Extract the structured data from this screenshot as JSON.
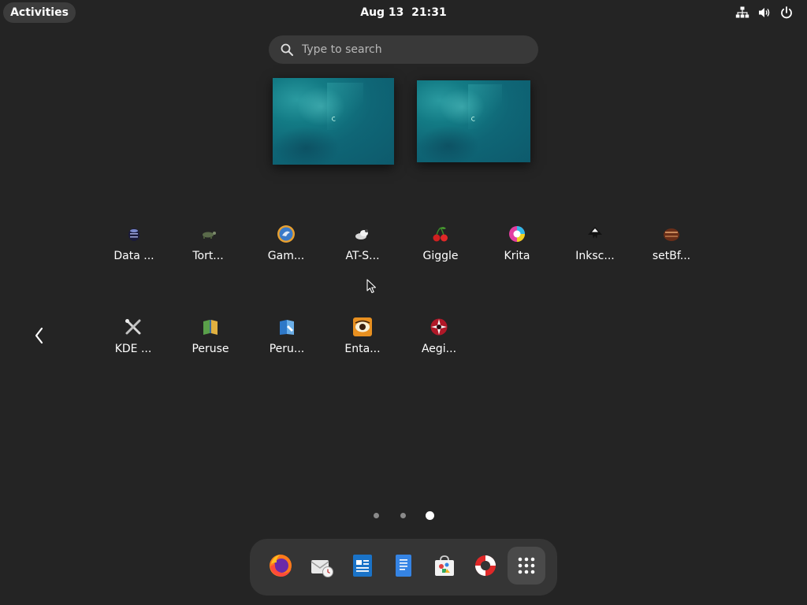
{
  "topbar": {
    "activities_label": "Activities",
    "clock_date": "Aug 13",
    "clock_time": "21:31",
    "tray_icons": [
      "network-icon",
      "volume-icon",
      "power-icon"
    ]
  },
  "search": {
    "placeholder": "Type to search",
    "value": ""
  },
  "workspaces": [
    {
      "name": "workspace-1"
    },
    {
      "name": "workspace-2"
    }
  ],
  "app_grid": {
    "rows": [
      [
        {
          "label": "Data ...",
          "icon": "data-icon"
        },
        {
          "label": "Tort...",
          "icon": "tortoise-icon"
        },
        {
          "label": "Gam...",
          "icon": "game-icon"
        },
        {
          "label": "AT-S...",
          "icon": "at-spi-icon"
        },
        {
          "label": "Giggle",
          "icon": "cherry-icon"
        },
        {
          "label": "Krita",
          "icon": "krita-icon"
        },
        {
          "label": "Inksc...",
          "icon": "inkscape-icon"
        },
        {
          "label": "setBf...",
          "icon": "setbf-icon"
        }
      ],
      [
        {
          "label": "KDE ...",
          "icon": "tools-icon"
        },
        {
          "label": "Peruse",
          "icon": "peruse-icon"
        },
        {
          "label": "Peru...",
          "icon": "peruse-creator-icon"
        },
        {
          "label": "Enta...",
          "icon": "eye-icon"
        },
        {
          "label": "Aegi...",
          "icon": "aegisub-icon"
        }
      ]
    ]
  },
  "pager": {
    "pages": 3,
    "current": 3
  },
  "dash": {
    "items": [
      {
        "name": "firefox",
        "icon": "firefox-icon"
      },
      {
        "name": "evolution",
        "icon": "mail-clock-icon"
      },
      {
        "name": "writer",
        "icon": "writer-icon"
      },
      {
        "name": "text-editor",
        "icon": "text-editor-icon"
      },
      {
        "name": "software",
        "icon": "software-bag-icon"
      },
      {
        "name": "help",
        "icon": "lifebuoy-icon"
      },
      {
        "name": "show-apps",
        "icon": "app-grid-icon"
      }
    ]
  },
  "colors": {
    "background": "#242424",
    "panel_button": "#3c3c3c",
    "search_bg": "#393939",
    "dash_bg": "#353535",
    "workspace_teal": "#137b85"
  }
}
